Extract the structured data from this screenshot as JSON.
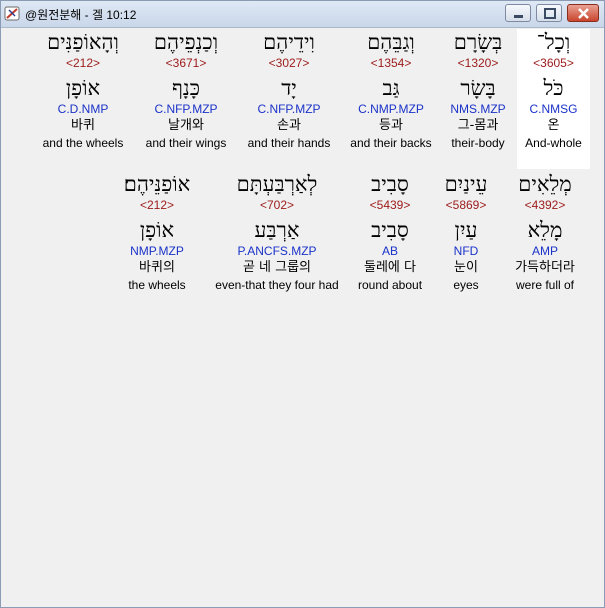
{
  "window": {
    "title": "@원전분해 - 겔 10:12",
    "icons": {
      "app": "book-icon",
      "minimize": "minimize-icon",
      "maximize": "maximize-icon",
      "close": "close-icon"
    }
  },
  "rows": [
    {
      "words": [
        {
          "heb": "וְכָל־",
          "strong": "<3605>",
          "root": "כֹּל",
          "morph": "C.NMSG",
          "kor": "온",
          "eng": "And-whole",
          "highlight": true
        },
        {
          "heb": "בְּשָׂרָם",
          "strong": "<1320>",
          "root": "בָּשָׂר",
          "morph": "NMS.MZP",
          "kor": "그-몸과",
          "eng": "their-body",
          "highlight": false
        },
        {
          "heb": "וְגַבֵּהֶם",
          "strong": "<1354>",
          "root": "גַּב",
          "morph": "C.NMP.MZP",
          "kor": "등과",
          "eng": "and their backs",
          "highlight": false
        },
        {
          "heb": "וִידֵיהֶם",
          "strong": "<3027>",
          "root": "יָד",
          "morph": "C.NFP.MZP",
          "kor": "손과",
          "eng": "and their hands",
          "highlight": false
        },
        {
          "heb": "וְכַנְפֵיהֶם",
          "strong": "<3671>",
          "root": "כָּנָף",
          "morph": "C.NFP.MZP",
          "kor": "날개와",
          "eng": "and their wings",
          "highlight": false
        },
        {
          "heb": "וְהָאוֹפַנִּים",
          "strong": "<212>",
          "root": "אוֹפָן",
          "morph": "C.D.NMP",
          "kor": "바퀴",
          "eng": "and the wheels",
          "highlight": false
        }
      ]
    },
    {
      "words": [
        {
          "heb": "מְלֵאִים",
          "strong": "<4392>",
          "root": "מָלֵא",
          "morph": "AMP",
          "kor": "가득하더라",
          "eng": "were full of",
          "highlight": false
        },
        {
          "heb": "עֵינַיִם",
          "strong": "<5869>",
          "root": "עַיִן",
          "morph": "NFD",
          "kor": "눈이",
          "eng": "eyes",
          "highlight": false
        },
        {
          "heb": "סָבִיב",
          "strong": "<5439>",
          "root": "סָבִיב",
          "morph": "AB",
          "kor": "둘레에 다",
          "eng": "round about",
          "highlight": false
        },
        {
          "heb": "לְאַרְבַּעְתָּם",
          "strong": "<702>",
          "root": "אַרְבַּע",
          "morph": "P.ANCFS.MZP",
          "kor": "곧 네 그룹의",
          "eng": "even-that they four had",
          "highlight": false
        },
        {
          "heb": "אוֹפַנֵּיהֶם׃",
          "strong": "<212>",
          "root": "אוֹפָן",
          "morph": "NMP.MZP",
          "kor": "바퀴의",
          "eng": "the wheels",
          "highlight": false
        }
      ]
    }
  ]
}
